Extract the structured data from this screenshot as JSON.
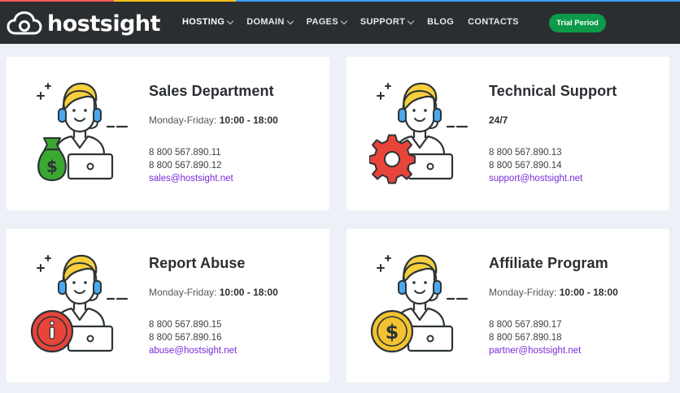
{
  "header": {
    "brand": "hostsight",
    "nav": [
      {
        "label": "HOSTING",
        "has_dropdown": true,
        "active": true
      },
      {
        "label": "DOMAIN",
        "has_dropdown": true,
        "active": false
      },
      {
        "label": "PAGES",
        "has_dropdown": true,
        "active": false
      },
      {
        "label": "SUPPORT",
        "has_dropdown": true,
        "active": false
      },
      {
        "label": "BLOG",
        "has_dropdown": false,
        "active": false
      },
      {
        "label": "CONTACTS",
        "has_dropdown": false,
        "active": false
      }
    ],
    "cta_label": "Trial Period"
  },
  "colors": {
    "topbar": "#2b2e31",
    "cta": "#0d9a4a",
    "email_link": "#7b2bd6",
    "sales_icon": "#3ba832",
    "support_icon": "#e8443a",
    "abuse_icon": "#e8443a",
    "affiliate_icon": "#f2c230"
  },
  "cards": [
    {
      "title": "Sales Department",
      "hours_label": "Monday-Friday:",
      "hours_value": "10:00 - 18:00",
      "phone1": "8 800 567.890.11",
      "phone2": "8 800 567.890.12",
      "email": "sales@hostsight.net",
      "icon": "money-bag-icon"
    },
    {
      "title": "Technical Support",
      "hours_label": "",
      "hours_value": "24/7",
      "phone1": "8 800 567.890.13",
      "phone2": "8 800 567.890.14",
      "email": "support@hostsight.net",
      "icon": "gear-icon"
    },
    {
      "title": "Report Abuse",
      "hours_label": "Monday-Friday:",
      "hours_value": "10:00 - 18:00",
      "phone1": "8 800 567.890.15",
      "phone2": "8 800 567.890.16",
      "email": "abuse@hostsight.net",
      "icon": "info-icon"
    },
    {
      "title": "Affiliate Program",
      "hours_label": "Monday-Friday:",
      "hours_value": "10:00 - 18:00",
      "phone1": "8 800 567.890.17",
      "phone2": "8 800 567.890.18",
      "email": "partner@hostsight.net",
      "icon": "dollar-coin-icon"
    }
  ]
}
